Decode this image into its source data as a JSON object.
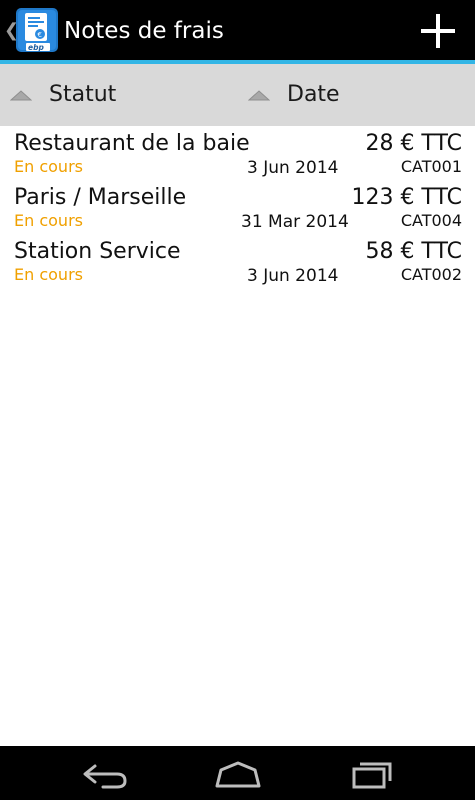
{
  "action_bar": {
    "title": "Notes de frais",
    "app_icon": "ebp-expense-icon",
    "app_icon_text": "ebp",
    "add_icon": "plus-icon",
    "up_icon": "chevron-left-icon",
    "background_color": "#000000",
    "accent_color": "#33b5e5"
  },
  "sort_bar": {
    "columns": [
      {
        "label": "Statut",
        "icon": "sort-triangle-icon"
      },
      {
        "label": "Date",
        "icon": "sort-triangle-icon"
      }
    ]
  },
  "expenses": [
    {
      "title": "Restaurant de la baie",
      "amount": "28 € TTC",
      "status": "En cours",
      "date": "3 Jun 2014",
      "category": "CAT001"
    },
    {
      "title": "Paris / Marseille",
      "amount": "123 € TTC",
      "status": "En cours",
      "date": "31 Mar 2014",
      "category": "CAT004"
    },
    {
      "title": "Station Service",
      "amount": "58 € TTC",
      "status": "En cours",
      "date": "3 Jun 2014",
      "category": "CAT002"
    }
  ],
  "status_color": "#f0a000",
  "nav_bar": {
    "buttons": [
      "back-icon",
      "home-icon",
      "recent-apps-icon"
    ]
  }
}
